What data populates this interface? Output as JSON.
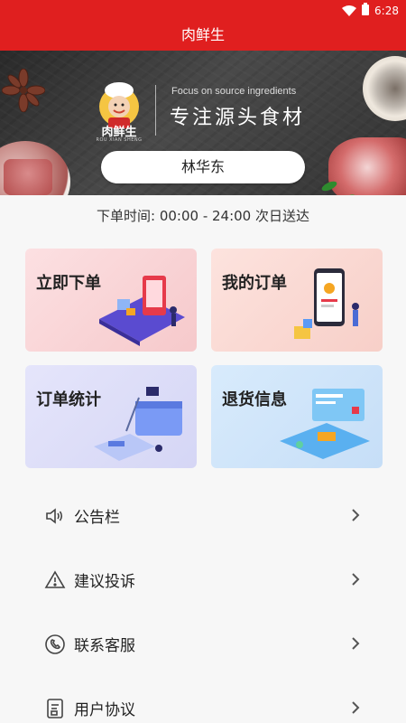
{
  "status_bar": {
    "time": "6:28",
    "icons": [
      "wifi-icon",
      "battery-icon"
    ]
  },
  "header": {
    "title": "肉鲜生"
  },
  "banner": {
    "brand_name": "肉鲜生",
    "brand_sub": "ROU XIAN SHENG",
    "slogan_en": "Focus on source ingredients",
    "slogan_cn": "专注源头食材",
    "store_name": "林华东"
  },
  "order_time": {
    "text": "下单时间: 00:00 - 24:00 次日送达"
  },
  "cards": [
    {
      "label": "立即下单",
      "icon": "order-illustration"
    },
    {
      "label": "我的订单",
      "icon": "phone-illustration"
    },
    {
      "label": "订单统计",
      "icon": "stats-illustration"
    },
    {
      "label": "退货信息",
      "icon": "return-illustration"
    }
  ],
  "menu": [
    {
      "label": "公告栏",
      "icon": "speaker-icon"
    },
    {
      "label": "建议投诉",
      "icon": "warning-icon"
    },
    {
      "label": "联系客服",
      "icon": "phone-icon"
    },
    {
      "label": "用户协议",
      "icon": "document-icon"
    }
  ],
  "colors": {
    "brand_red": "#e01f1f",
    "background": "#f7f7f7"
  }
}
